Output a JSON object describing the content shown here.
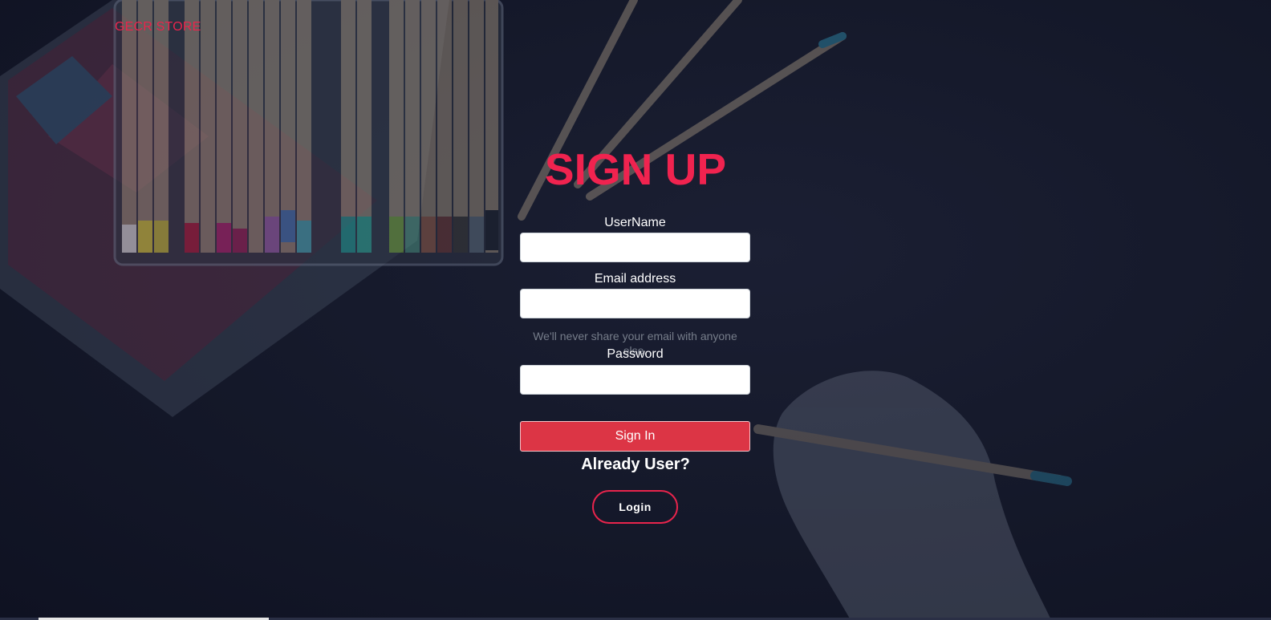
{
  "brand": {
    "name": "GECR STORE"
  },
  "form": {
    "title": "SIGN UP",
    "username_label": "UserName",
    "username_value": "",
    "email_label": "Email address",
    "email_value": "",
    "email_help": "We'll never share your email with anyone else.",
    "password_label": "Password",
    "password_value": "",
    "submit_label": "Sign In"
  },
  "footer": {
    "prompt": "Already User?",
    "login_label": "Login"
  },
  "colors": {
    "accent": "#f0234f",
    "submit_bg": "#dc3545",
    "background": "#141829"
  }
}
